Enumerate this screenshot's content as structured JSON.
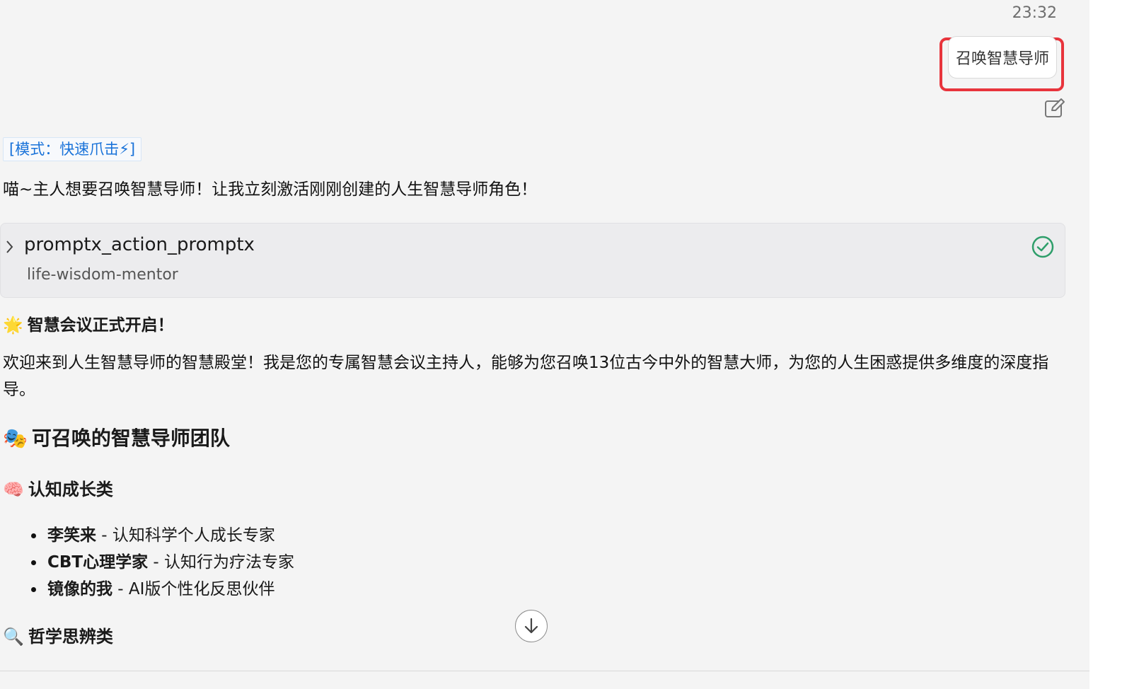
{
  "message": {
    "timestamp": "23:32",
    "user_text": "召唤智慧导师"
  },
  "assistant": {
    "mode_tag": "[模式：快速爪击⚡]",
    "intro": "喵~主人想要召唤智慧导师！让我立刻激活刚刚创建的人生智慧导师角色！",
    "tool_call": {
      "name": "promptx_action_promptx",
      "argument": "life-wisdom-mentor",
      "status": "success"
    },
    "heading_opening": {
      "emoji": "🌟",
      "text": "智慧会议正式开启！"
    },
    "welcome_paragraph": "欢迎来到人生智慧导师的智慧殿堂！我是您的专属智慧会议主持人，能够为您召唤13位古今中外的智慧大师，为您的人生困惑提供多维度的深度指导。",
    "heading_team": {
      "emoji": "🎭",
      "text": "可召唤的智慧导师团队"
    },
    "category_cognitive": {
      "emoji": "🧠",
      "text": "认知成长类"
    },
    "mentors_cognitive": [
      {
        "name": "李笑来",
        "desc": " - 认知科学个人成长专家"
      },
      {
        "name": "CBT心理学家",
        "desc": " - 认知行为疗法专家"
      },
      {
        "name": "镜像的我",
        "desc": " - AI版个性化反思伙伴"
      }
    ],
    "category_philosophy": {
      "emoji": "🔍",
      "text": "哲学思辨类"
    }
  },
  "icons": {
    "edit": "edit-icon",
    "chevron": "chevron-right-icon",
    "status": "check-circle-icon",
    "scroll": "arrow-down-icon"
  },
  "colors": {
    "highlight_border": "#e8343c",
    "mode_tag": "#1a73d9",
    "success": "#2e9e6a"
  }
}
